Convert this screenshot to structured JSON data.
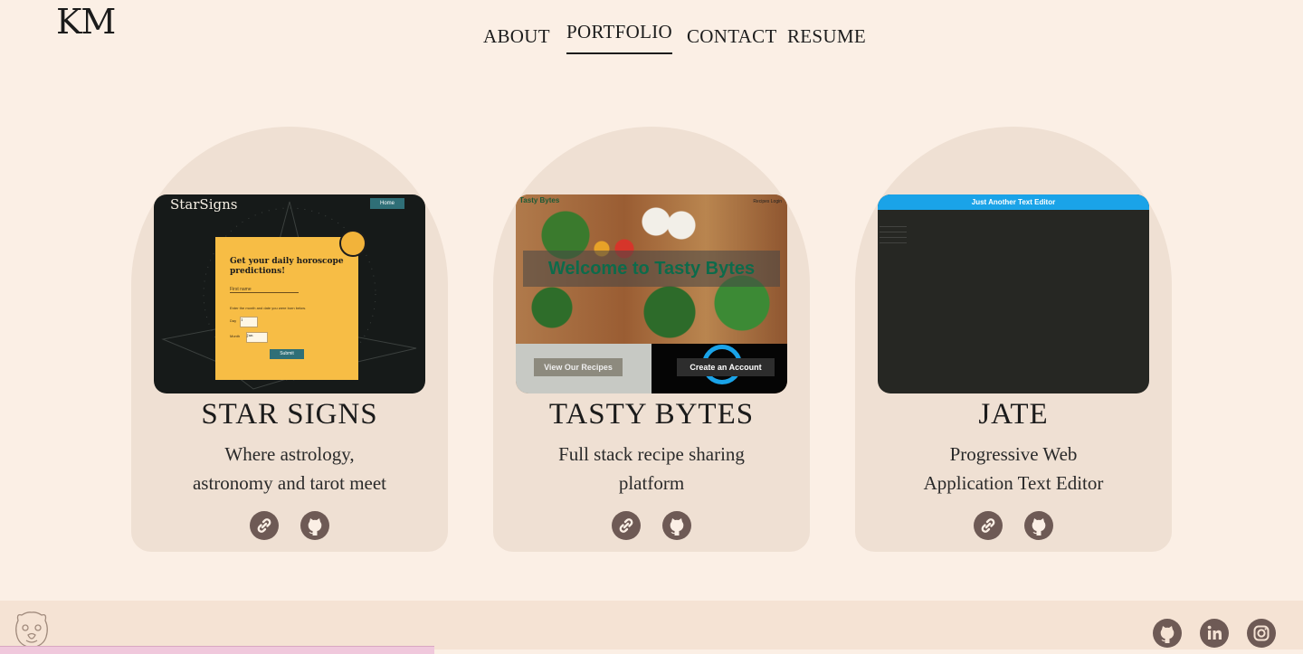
{
  "logo": "KM",
  "nav": {
    "items": [
      {
        "label": "ABOUT",
        "active": false
      },
      {
        "label": "PORTFOLIO",
        "active": true
      },
      {
        "label": "CONTACT",
        "active": false
      },
      {
        "label": "RESUME",
        "active": false
      }
    ]
  },
  "projects": [
    {
      "title": "STAR SIGNS",
      "description_line1": "Where astrology,",
      "description_line2": "astronomy and tarot meet",
      "screenshot": {
        "brand": "StarSigns",
        "home_button": "Home",
        "form_title": "Get your daily horoscope predictions!",
        "name_placeholder": "First name",
        "instruction": "Enter the month and date you were born below.",
        "day_label": "Day",
        "day_value": "1",
        "month_label": "Month",
        "month_value": "Jan",
        "submit": "Submit"
      },
      "icons": [
        "link-icon",
        "github-icon"
      ]
    },
    {
      "title": "TASTY BYTES",
      "description_line1": "Full stack recipe sharing",
      "description_line2": "platform",
      "screenshot": {
        "brand": "Tasty Bytes",
        "nav_links": "Recipes   Login",
        "welcome": "Welcome to Tasty Bytes",
        "view_recipes": "View Our Recipes",
        "create_account": "Create an Account"
      },
      "icons": [
        "link-icon",
        "github-icon"
      ]
    },
    {
      "title": "JATE",
      "description_line1": "Progressive Web",
      "description_line2": "Application Text Editor",
      "screenshot": {
        "header": "Just Another Text Editor"
      },
      "icons": [
        "link-icon",
        "github-icon"
      ]
    }
  ],
  "footer": {
    "icons": [
      "github-icon",
      "linkedin-icon",
      "instagram-icon"
    ]
  },
  "colors": {
    "background": "#fbefe5",
    "card": "#efe0d3",
    "icon": "#6e5a55",
    "footer": "#f5e3d4"
  }
}
